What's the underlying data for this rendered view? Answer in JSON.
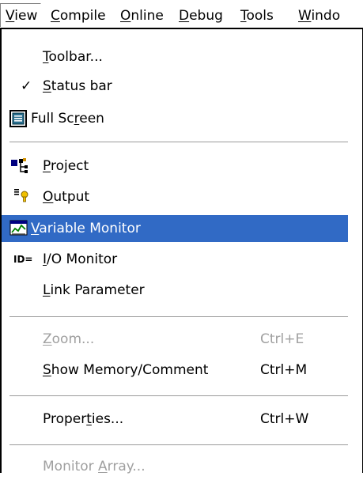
{
  "menubar": {
    "items": [
      {
        "label": "View",
        "key": "V",
        "rest": "iew"
      },
      {
        "label": "Compile",
        "key": "C",
        "rest": "ompile"
      },
      {
        "label": "Online",
        "key": "O",
        "rest": "nline"
      },
      {
        "label": "Debug",
        "key": "D",
        "rest": "ebug"
      },
      {
        "label": "Tools",
        "key": "T",
        "rest": "ools"
      },
      {
        "label": "Windo",
        "key": "W",
        "rest": "indo"
      }
    ]
  },
  "menu": {
    "toolbar": {
      "pre": "",
      "key": "T",
      "post": "oolbar..."
    },
    "status_bar": {
      "check": "✓",
      "pre": "",
      "key": "S",
      "post": "tatus bar"
    },
    "full_screen": {
      "pre": "Full Sc",
      "key": "r",
      "post": "een"
    },
    "project": {
      "pre": "",
      "key": "P",
      "post": "roject"
    },
    "output": {
      "pre": "",
      "key": "O",
      "post": "utput"
    },
    "variable_monitor": {
      "pre": "",
      "key": "V",
      "post": "ariable Monitor"
    },
    "io_monitor": {
      "icon_text": "ID=",
      "pre": "",
      "key": "I",
      "post": "/O Monitor"
    },
    "link_parameter": {
      "pre": "",
      "key": "L",
      "post": "ink Parameter"
    },
    "zoom": {
      "pre": "",
      "key": "Z",
      "post": "oom...",
      "shortcut": "Ctrl+E"
    },
    "show_memory": {
      "pre": "",
      "key": "S",
      "post": "how Memory/Comment",
      "shortcut": "Ctrl+M"
    },
    "properties": {
      "pre": "Proper",
      "key": "t",
      "post": "ies...",
      "shortcut": "Ctrl+W"
    },
    "monitor_array": {
      "pre": "Monitor ",
      "key": "A",
      "post": "rray..."
    }
  },
  "colors": {
    "highlight": "#316ac5",
    "disabled_text": "#a0a0a0",
    "background": "#ffffff"
  }
}
